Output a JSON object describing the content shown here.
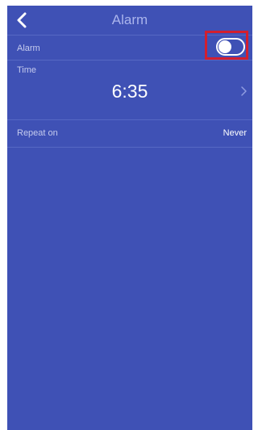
{
  "header": {
    "title": "Alarm",
    "back_icon": "chevron-left-icon"
  },
  "alarm": {
    "label": "Alarm",
    "enabled": false
  },
  "time": {
    "label": "Time",
    "value": "6:35",
    "chevron_icon": "chevron-right-icon"
  },
  "repeat": {
    "label": "Repeat on",
    "value": "Never"
  },
  "colors": {
    "background": "#3f51b5",
    "highlight": "#d21f2f"
  }
}
